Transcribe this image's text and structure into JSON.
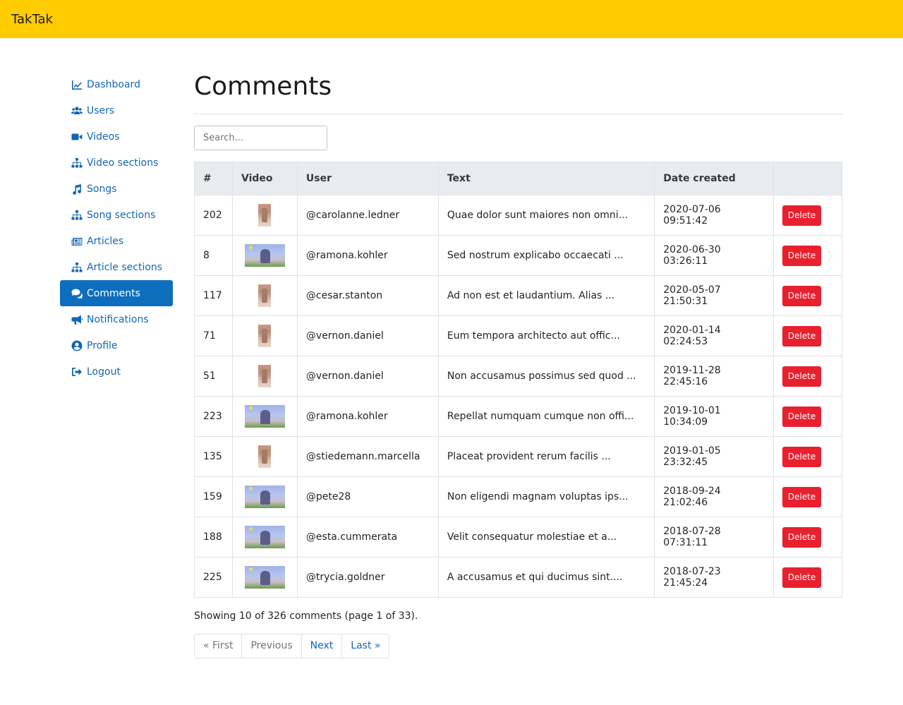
{
  "app": {
    "title": "TakTak"
  },
  "sidebar": {
    "items": [
      {
        "label": "Dashboard",
        "icon": "chart-line-icon"
      },
      {
        "label": "Users",
        "icon": "users-icon"
      },
      {
        "label": "Videos",
        "icon": "video-camera-icon"
      },
      {
        "label": "Video sections",
        "icon": "sitemap-icon"
      },
      {
        "label": "Songs",
        "icon": "music-note-icon"
      },
      {
        "label": "Song sections",
        "icon": "sitemap-icon"
      },
      {
        "label": "Articles",
        "icon": "newspaper-icon"
      },
      {
        "label": "Article sections",
        "icon": "sitemap-icon"
      },
      {
        "label": "Comments",
        "icon": "comments-icon",
        "active": true
      },
      {
        "label": "Notifications",
        "icon": "bullhorn-icon"
      },
      {
        "label": "Profile",
        "icon": "user-circle-icon"
      },
      {
        "label": "Logout",
        "icon": "sign-out-icon"
      }
    ]
  },
  "main": {
    "title": "Comments",
    "search": {
      "placeholder": "Search...",
      "value": ""
    },
    "table": {
      "headers": [
        "#",
        "Video",
        "User",
        "Text",
        "Date created",
        ""
      ],
      "rows": [
        {
          "id": "202",
          "thumb": "portrait",
          "user": "@carolanne.ledner",
          "text": "Quae dolor sunt maiores non omni...",
          "date": "2020-07-06 09:51:42",
          "action": "Delete"
        },
        {
          "id": "8",
          "thumb": "landscape",
          "user": "@ramona.kohler",
          "text": "Sed nostrum explicabo occaecati ...",
          "date": "2020-06-30 03:26:11",
          "action": "Delete"
        },
        {
          "id": "117",
          "thumb": "portrait",
          "user": "@cesar.stanton",
          "text": "Ad non est et laudantium. Alias ...",
          "date": "2020-05-07 21:50:31",
          "action": "Delete"
        },
        {
          "id": "71",
          "thumb": "portrait",
          "user": "@vernon.daniel",
          "text": "Eum tempora architecto aut offic...",
          "date": "2020-01-14 02:24:53",
          "action": "Delete"
        },
        {
          "id": "51",
          "thumb": "portrait",
          "user": "@vernon.daniel",
          "text": "Non accusamus possimus sed quod ...",
          "date": "2019-11-28 22:45:16",
          "action": "Delete"
        },
        {
          "id": "223",
          "thumb": "landscape",
          "user": "@ramona.kohler",
          "text": "Repellat numquam cumque non offi...",
          "date": "2019-10-01 10:34:09",
          "action": "Delete"
        },
        {
          "id": "135",
          "thumb": "portrait",
          "user": "@stiedemann.marcella",
          "text": "Placeat provident rerum facilis ...",
          "date": "2019-01-05 23:32:45",
          "action": "Delete"
        },
        {
          "id": "159",
          "thumb": "landscape",
          "user": "@pete28",
          "text": "Non eligendi magnam voluptas ips...",
          "date": "2018-09-24 21:02:46",
          "action": "Delete"
        },
        {
          "id": "188",
          "thumb": "landscape",
          "user": "@esta.cummerata",
          "text": "Velit consequatur molestiae et a...",
          "date": "2018-07-28 07:31:11",
          "action": "Delete"
        },
        {
          "id": "225",
          "thumb": "landscape",
          "user": "@trycia.goldner",
          "text": "A accusamus et qui ducimus sint....",
          "date": "2018-07-23 21:45:24",
          "action": "Delete"
        }
      ]
    },
    "summary": "Showing 10 of 326 comments (page 1 of 33).",
    "pagination": {
      "first": "« First",
      "previous": "Previous",
      "next": "Next",
      "last": "Last »"
    }
  },
  "colors": {
    "topbar": "#ffcc00",
    "link": "#1266b8",
    "active_nav": "#0d6ebe",
    "delete_button": "#e8202e"
  }
}
